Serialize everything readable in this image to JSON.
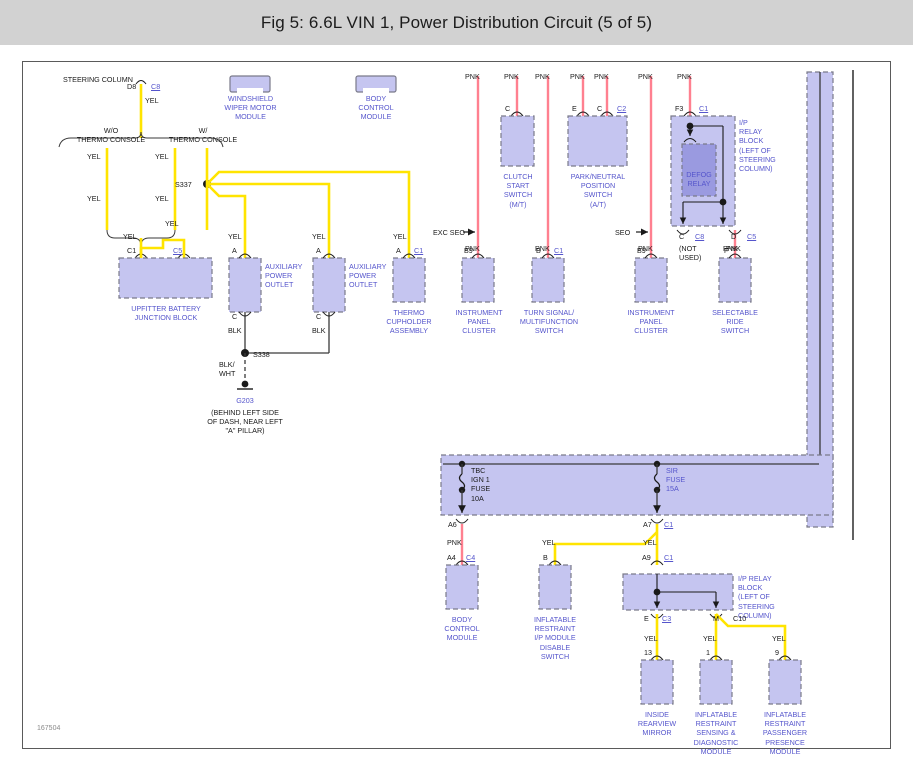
{
  "header": {
    "title": "Fig 5: 6.6L VIN 1, Power Distribution Circuit (5 of 5)"
  },
  "diagram": {
    "reference_number": "167504",
    "colors": {
      "wire_yellow": "#ffe400",
      "wire_pink": "#ff8090",
      "wire_black": "#3a3a3a",
      "component_fill": "#c5c5f0",
      "component_border": "#7a7a8a",
      "relay_fill": "#9a9ae0",
      "label_blue": "#5555cc",
      "title_bar": "#d2d2d2"
    },
    "top_section": {
      "steering_column_label": "STEERING COLUMN",
      "steering_column_pin": "D8",
      "steering_column_connector": "C8",
      "steering_wire": "YEL",
      "branch_left_label": "W/O\nTHERMO CONSOLE",
      "branch_right_label": "W/\nTHERMO CONSOLE",
      "branch_left_wire_top": "YEL",
      "branch_left_wire_bottom": "YEL",
      "branch_right_wire_top": "YEL",
      "branch_right_wire_bottom": "YEL",
      "splice_label": "S337"
    },
    "ground_path": {
      "splice_label": "S338",
      "wire_color": "BLK/\nWHT",
      "ground_id": "G203",
      "ground_location": "(BEHIND LEFT SIDE\nOF DASH, NEAR LEFT\n\"A\" PILLAR)"
    },
    "seo_markers": [
      {
        "label": "EXC SEO",
        "arrow": "→"
      },
      {
        "label": "SEO",
        "arrow": "→"
      }
    ],
    "relay_block_top": {
      "title": "I/P\nRELAY\nBLOCK\n(LEFT OF\nSTEERING\nCOLUMN)",
      "top_pin": "F3",
      "top_connector": "C1",
      "top_wire": "PNK",
      "relay_name": "DEFOG\nRELAY",
      "out_left_pin": "C",
      "out_left_connector": "C8",
      "out_left_note": "(NOT\nUSED)",
      "out_right_pin": "D",
      "out_right_connector": "C5",
      "out_right_wire": "PNK"
    },
    "relay_block_bottom": {
      "title": "I/P RELAY\nBLOCK\n(LEFT OF\nSTEERING\nCOLUMN)",
      "in_pin": "A9",
      "in_connector": "C1",
      "out_left_pin": "E",
      "out_left_connector": "C3",
      "out_right_pin": "M",
      "connector_label": "C10"
    },
    "fuse_block": {
      "fuses": [
        {
          "name": "TBC\nIGN 1\nFUSE\n10A",
          "out_pin": "A6"
        },
        {
          "name": "SIR\nFUSE\n15A",
          "out_pin": "A7",
          "out_connector": "C1"
        }
      ]
    },
    "components_top": [
      {
        "name": "WINDSHIELD\nWIPER MOTOR\nMODULE",
        "style": "solid"
      },
      {
        "name": "BODY\nCONTROL\nMODULE",
        "style": "solid"
      },
      {
        "name": "CLUTCH\nSTART\nSWITCH\n(M/T)",
        "pins": [
          "C"
        ],
        "wires": [
          "PNK"
        ]
      },
      {
        "name": "PARK/NEUTRAL\nPOSITION\nSWITCH\n(A/T)",
        "pins": [
          "E",
          "C"
        ],
        "connector": "C2",
        "wires": [
          "PNK",
          "PNK"
        ]
      }
    ],
    "components_mid": [
      {
        "name": "UPFITTER BATTERY\nJUNCTION BLOCK",
        "pins": [
          "C1",
          "C5"
        ],
        "wires": [
          "YEL",
          "YEL"
        ]
      },
      {
        "name": "AUXILIARY\nPOWER\nOUTLET",
        "pin_top": "A",
        "wire_top": "YEL",
        "pin_bottom": "C",
        "wire_bottom": "BLK"
      },
      {
        "name": "AUXILIARY\nPOWER\nOUTLET",
        "pin_top": "A",
        "wire_top": "YEL",
        "pin_bottom": "C",
        "wire_bottom": "BLK"
      },
      {
        "name": "THERMO\nCUPHOLDER\nASSEMBLY",
        "pin_top": "A",
        "connector": "C1",
        "wire_top": "YEL"
      },
      {
        "name": "INSTRUMENT\nPANEL\nCLUSTER",
        "pin_top": "B9",
        "wire_top": "PNK"
      },
      {
        "name": "TURN SIGNAL/\nMULTIFUNCTION\nSWITCH",
        "pin_top": "B",
        "connector": "C1",
        "wire_top": "PNK"
      },
      {
        "name": "INSTRUMENT\nPANEL\nCLUSTER",
        "pin_top": "B9",
        "wire_top": "PNK"
      },
      {
        "name": "SELECTABLE\nRIDE\nSWITCH",
        "pin_top": "F",
        "wire_top": "PNK"
      }
    ],
    "components_bottom": [
      {
        "name": "BODY\nCONTROL\nMODULE",
        "pin_top": "A4",
        "connector": "C4",
        "wire_top": "PNK"
      },
      {
        "name": "INFLATABLE\nRESTRAINT\nI/P MODULE\nDISABLE\nSWITCH",
        "pin_top": "B",
        "wire_top": "YEL"
      },
      {
        "name": "INSIDE\nREARVIEW\nMIRROR",
        "pin_top": "13",
        "wire_top": "YEL"
      },
      {
        "name": "INFLATABLE\nRESTRAINT\nSENSING &\nDIAGNOSTIC\nMODULE",
        "pin_top": "1",
        "wire_top": "YEL"
      },
      {
        "name": "INFLATABLE\nRESTRAINT\nPASSENGER\nPRESENCE\nMODULE",
        "pin_top": "9",
        "wire_top": "YEL"
      }
    ]
  }
}
